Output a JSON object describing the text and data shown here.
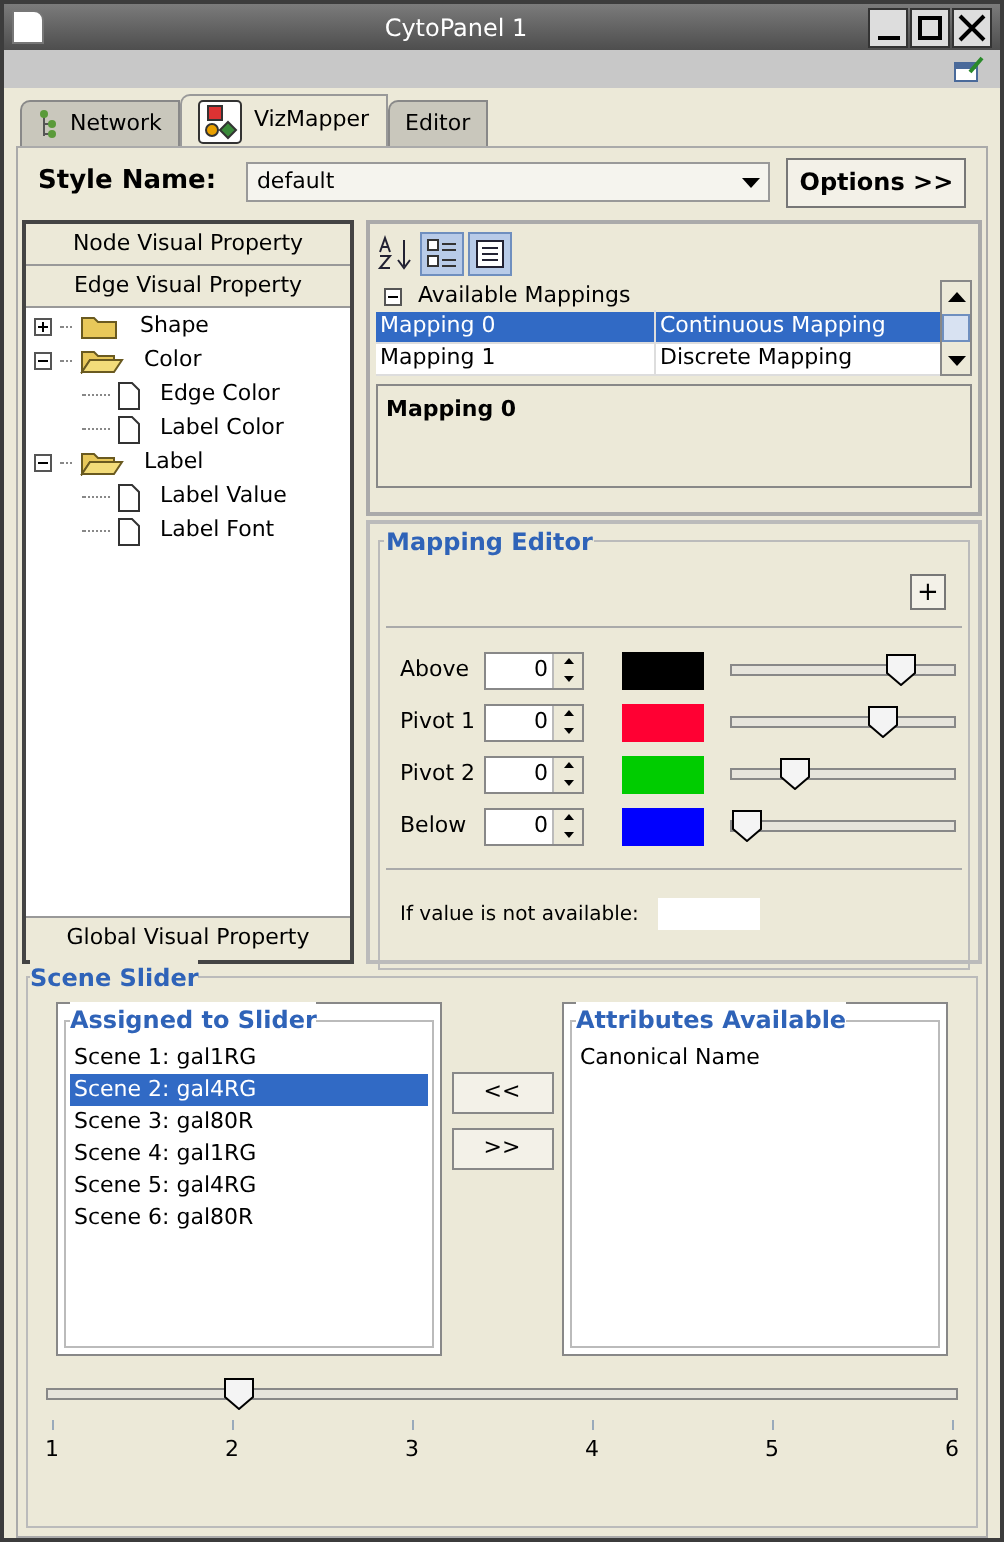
{
  "window": {
    "title": "CytoPanel 1"
  },
  "tabs": [
    {
      "label": "Network",
      "selected": false,
      "kind": "network"
    },
    {
      "label": "VizMapper",
      "selected": true,
      "kind": "vizmapper"
    },
    {
      "label": "Editor",
      "selected": false,
      "kind": "plain"
    }
  ],
  "style": {
    "label": "Style Name:",
    "value": "default",
    "options_button": "Options >>"
  },
  "property_buttons": {
    "top": [
      "Node Visual Property",
      "Edge Visual Property"
    ],
    "bottom": "Global Visual Property"
  },
  "tree": [
    {
      "label": "Shape",
      "expanded": false
    },
    {
      "label": "Color",
      "expanded": true,
      "children": [
        {
          "label": "Edge Color"
        },
        {
          "label": "Label Color"
        }
      ]
    },
    {
      "label": "Label",
      "expanded": true,
      "children": [
        {
          "label": "Label Value"
        },
        {
          "label": "Label Font"
        }
      ]
    }
  ],
  "mappings": {
    "header": "Available Mappings",
    "expanded": true,
    "rows": [
      {
        "name": "Mapping 0",
        "type": "Continuous Mapping",
        "selected": true
      },
      {
        "name": "Mapping 1",
        "type": "Discrete Mapping",
        "selected": false
      }
    ],
    "description": "Mapping 0"
  },
  "mapping_editor": {
    "title": "Mapping Editor",
    "add_button": "+",
    "points": [
      {
        "label": "Above",
        "value": "0",
        "color": "#000000",
        "level": 0.8
      },
      {
        "label": "Pivot 1",
        "value": "0",
        "color": "#ff0033",
        "level": 0.71
      },
      {
        "label": "Pivot 2",
        "value": "0",
        "color": "#00cc00",
        "level": 0.25
      },
      {
        "label": "Below",
        "value": "0",
        "color": "#0000ff",
        "level": 0.0
      }
    ],
    "unavailable_label": "If value is not available:"
  },
  "scene_slider": {
    "title": "Scene Slider",
    "assigned_title": "Assigned to Slider",
    "assigned": [
      {
        "label": "Scene 1: gal1RG",
        "selected": false
      },
      {
        "label": "Scene 2: gal4RG",
        "selected": true
      },
      {
        "label": "Scene 3: gal80R",
        "selected": false
      },
      {
        "label": "Scene 4: gal1RG",
        "selected": false
      },
      {
        "label": "Scene 5: gal4RG",
        "selected": false
      },
      {
        "label": "Scene 6: gal80R",
        "selected": false
      }
    ],
    "buttons": [
      "<<",
      ">>"
    ],
    "available_title": "Attributes Available",
    "available": [
      {
        "label": "Canonical Name",
        "selected": false
      }
    ],
    "level": 0.2,
    "ticks": [
      "1",
      "2",
      "3",
      "4",
      "5",
      "6"
    ]
  }
}
